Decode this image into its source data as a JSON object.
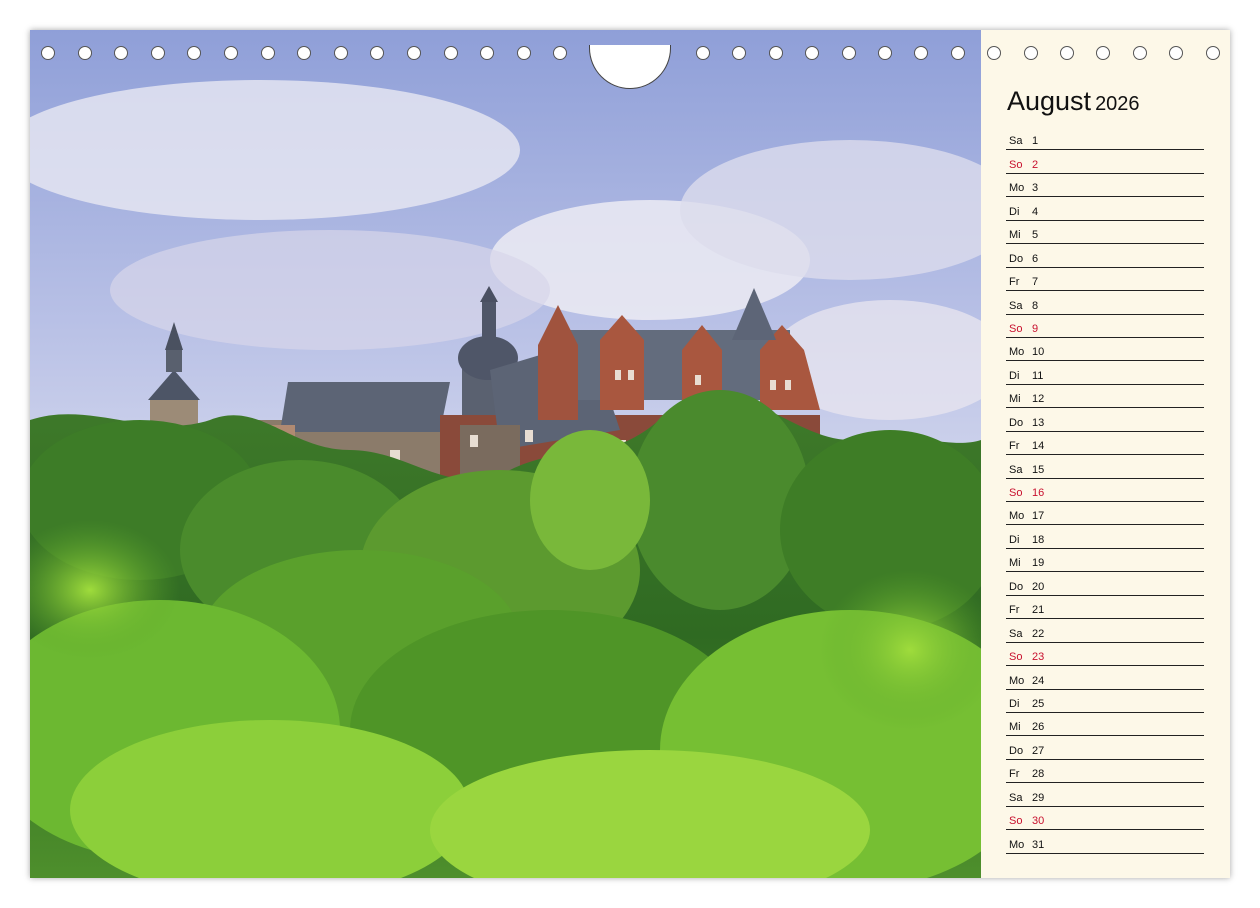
{
  "calendar": {
    "month": "August",
    "year": "2026",
    "colors": {
      "sunday": "#c8102e",
      "text": "#111111",
      "panel": "#fdf8e8"
    },
    "days": [
      {
        "weekday": "Sa",
        "day": "1",
        "sunday": false
      },
      {
        "weekday": "So",
        "day": "2",
        "sunday": true
      },
      {
        "weekday": "Mo",
        "day": "3",
        "sunday": false
      },
      {
        "weekday": "Di",
        "day": "4",
        "sunday": false
      },
      {
        "weekday": "Mi",
        "day": "5",
        "sunday": false
      },
      {
        "weekday": "Do",
        "day": "6",
        "sunday": false
      },
      {
        "weekday": "Fr",
        "day": "7",
        "sunday": false
      },
      {
        "weekday": "Sa",
        "day": "8",
        "sunday": false
      },
      {
        "weekday": "So",
        "day": "9",
        "sunday": true
      },
      {
        "weekday": "Mo",
        "day": "10",
        "sunday": false
      },
      {
        "weekday": "Di",
        "day": "11",
        "sunday": false
      },
      {
        "weekday": "Mi",
        "day": "12",
        "sunday": false
      },
      {
        "weekday": "Do",
        "day": "13",
        "sunday": false
      },
      {
        "weekday": "Fr",
        "day": "14",
        "sunday": false
      },
      {
        "weekday": "Sa",
        "day": "15",
        "sunday": false
      },
      {
        "weekday": "So",
        "day": "16",
        "sunday": true
      },
      {
        "weekday": "Mo",
        "day": "17",
        "sunday": false
      },
      {
        "weekday": "Di",
        "day": "18",
        "sunday": false
      },
      {
        "weekday": "Mi",
        "day": "19",
        "sunday": false
      },
      {
        "weekday": "Do",
        "day": "20",
        "sunday": false
      },
      {
        "weekday": "Fr",
        "day": "21",
        "sunday": false
      },
      {
        "weekday": "Sa",
        "day": "22",
        "sunday": false
      },
      {
        "weekday": "So",
        "day": "23",
        "sunday": true
      },
      {
        "weekday": "Mo",
        "day": "24",
        "sunday": false
      },
      {
        "weekday": "Di",
        "day": "25",
        "sunday": false
      },
      {
        "weekday": "Mi",
        "day": "26",
        "sunday": false
      },
      {
        "weekday": "Do",
        "day": "27",
        "sunday": false
      },
      {
        "weekday": "Fr",
        "day": "28",
        "sunday": false
      },
      {
        "weekday": "Sa",
        "day": "29",
        "sunday": false
      },
      {
        "weekday": "So",
        "day": "30",
        "sunday": true
      },
      {
        "weekday": "Mo",
        "day": "31",
        "sunday": false
      }
    ]
  }
}
